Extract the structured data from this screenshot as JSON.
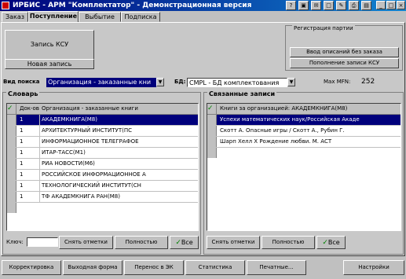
{
  "window": {
    "title": "ИРБИС - АРМ \"Комплектатор\" - Демонстрационная версия"
  },
  "toolbar_icons": [
    "help-icon",
    "book-icon",
    "mail-icon",
    "blank-icon",
    "edit-icon",
    "printer-icon",
    "window-icon"
  ],
  "tabs": [
    {
      "label": "Заказ",
      "active": false
    },
    {
      "label": "Поступление",
      "active": true
    },
    {
      "label": "Выбытие",
      "active": false
    },
    {
      "label": "Подписка",
      "active": false
    }
  ],
  "record": {
    "box_label": "Запись КСУ",
    "new_label": "Новая запись"
  },
  "registration": {
    "title": "Регистрация партии",
    "btn1": "Ввод описаний без заказа",
    "btn2": "Пополнение записи КСУ"
  },
  "search": {
    "kind_label": "Вид поиска",
    "kind_value": "Организация - заказанные кни",
    "db_label": "БД:",
    "db_value": "CMPL - БД комплектования",
    "mfn_label": "Max MFN:",
    "mfn_value": "252"
  },
  "dictionary": {
    "title": "Словарь",
    "columns": [
      "Док-ов",
      "Организация - заказанные книги"
    ],
    "rows": [
      {
        "count": "1",
        "name": "АКАДЕМКНИГА(М8)",
        "selected": true
      },
      {
        "count": "1",
        "name": "АРХИТЕКТУРНЫЙ ИНСТИТУТ(ПС"
      },
      {
        "count": "1",
        "name": "ИНФОРМАЦИОННОЕ ТЕЛЕГРАФОЕ"
      },
      {
        "count": "1",
        "name": "ИТАР-ТАСС(М1)"
      },
      {
        "count": "1",
        "name": "РИА НОВОСТИ(М6)"
      },
      {
        "count": "1",
        "name": "РОССИЙСКОЕ ИНФОРМАЦИОННОЕ А"
      },
      {
        "count": "1",
        "name": "ТЕХНОЛОГИЧЕСКИЙ ИНСТИТУТ(СН"
      },
      {
        "count": "1",
        "name": "ТФ АКАДЕМКНИГА РАН(М8)"
      }
    ],
    "key_label": "Ключ:",
    "key_value": "",
    "clear_btn": "Снять отметки",
    "full_btn": "Полностью",
    "all_btn": "Все"
  },
  "linked": {
    "title": "Связанные записи",
    "header": "Книги за организацией: АКАДЕМКНИГА(М8)",
    "rows": [
      {
        "text": "Успехи математических наук/Российская Акаде",
        "selected": true
      },
      {
        "text": "Скотт А. Опасные игры / Скотт А., Рубин Г."
      },
      {
        "text": "Шарп Хелл X Рождение любви. М. АСТ"
      }
    ],
    "clear_btn": "Снять отметки",
    "full_btn": "Полностью",
    "all_btn": "Все"
  },
  "bottom": {
    "correct": "Корректировка",
    "output": "Выходная форма",
    "transfer": "Перенос в ЭК",
    "stats": "Статистика",
    "print": "Печатные...",
    "settings": "Настройки"
  }
}
